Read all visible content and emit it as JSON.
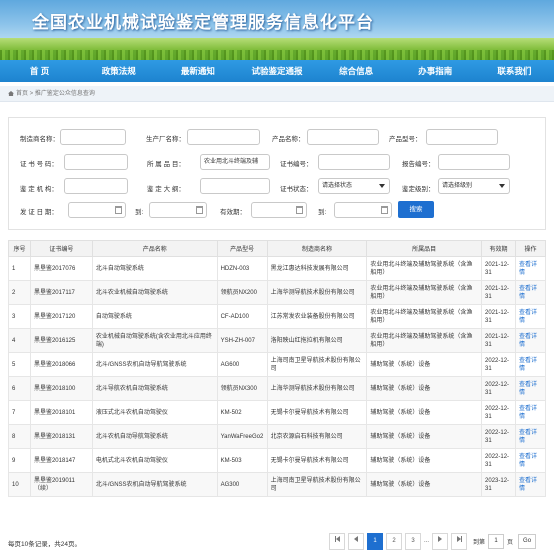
{
  "site": {
    "title": "全国农业机械试验鉴定管理服务信息化平台"
  },
  "nav": [
    "首 页",
    "政策法规",
    "最新通知",
    "试验鉴定通报",
    "综合信息",
    "办事指南",
    "联系我们"
  ],
  "breadcrumb": {
    "home": "首页",
    "sep": " > ",
    "current": "推广鉴定公众信息查询"
  },
  "search": {
    "manufacturer_label": "制造商名称：",
    "producer_label": "生产厂名称：",
    "product_label": "产品名称：",
    "model_label": "产品型号：",
    "cert_no_label": "证 书 号 码：",
    "category_label": "所 属 品 目：",
    "category_value": "农业用北斗终端及辅",
    "cert_id_label": "证书编号：",
    "report_label": "报告编号：",
    "agency_label": "鉴 定 机 构：",
    "outline_label": "鉴 定 大 纲：",
    "status_label": "证书状态：",
    "status_value": "请选择状态",
    "level_label": "鉴定级别：",
    "level_value": "请选择级别",
    "issue_date_label": "发 证 日 期：",
    "to_label": "到:",
    "validity_label": "有效期：",
    "to_label2": "到:",
    "button": "搜索"
  },
  "table": {
    "headers": [
      "序号",
      "证书编号",
      "产品名称",
      "产品型号",
      "制造商名称",
      "所属品目",
      "有效期",
      "操作"
    ],
    "rows": [
      {
        "no": "1",
        "cert": "黑垦鉴2017076",
        "name": "北斗自动驾驶系统",
        "model": "HDZN-003",
        "maker": "黑龙江惠达科技发展有限公司",
        "cat": "农业用北斗终端及辅助驾驶系统（含渔船用）",
        "valid": "2021-12-31",
        "op": "查看详情"
      },
      {
        "no": "2",
        "cert": "黑垦鉴2017117",
        "name": "北斗农业机械自动驾驶系统",
        "model": "领航员NX200",
        "maker": "上海华测导航技术股份有限公司",
        "cat": "农业用北斗终端及辅助驾驶系统（含渔船用）",
        "valid": "2021-12-31",
        "op": "查看详情"
      },
      {
        "no": "3",
        "cert": "黑垦鉴2017120",
        "name": "自动驾驶系统",
        "model": "CF-AD100",
        "maker": "江苏常发农业装备股份有限公司",
        "cat": "农业用北斗终端及辅助驾驶系统（含渔船用）",
        "valid": "2021-12-31",
        "op": "查看详情"
      },
      {
        "no": "4",
        "cert": "黑垦鉴2016125",
        "name": "农业机械自动驾驶系统(含农业用北斗应用终端)",
        "model": "YSH-ZH-007",
        "maker": "洛阳映山红拖拉机有限公司",
        "cat": "农业用北斗终端及辅助驾驶系统（含渔船用）",
        "valid": "2021-12-31",
        "op": "查看详情"
      },
      {
        "no": "5",
        "cert": "黑垦鉴2018066",
        "name": "北斗/GNSS农机自动导航驾驶系统",
        "model": "AG600",
        "maker": "上海司南卫星导航技术股份有限公司",
        "cat": "辅助驾驶（系统）设备",
        "valid": "2022-12-31",
        "op": "查看详情"
      },
      {
        "no": "6",
        "cert": "黑垦鉴2018100",
        "name": "北斗导航农机自动驾驶系统",
        "model": "领航员NX300",
        "maker": "上海华测导航技术股份有限公司",
        "cat": "辅助驾驶（系统）设备",
        "valid": "2022-12-31",
        "op": "查看详情"
      },
      {
        "no": "7",
        "cert": "黑垦鉴2018101",
        "name": "液压式北斗农机自动驾驶仪",
        "model": "KM-502",
        "maker": "无锡卡尔曼导航技术有限公司",
        "cat": "辅助驾驶（系统）设备",
        "valid": "2022-12-31",
        "op": "查看详情"
      },
      {
        "no": "8",
        "cert": "黑垦鉴2018131",
        "name": "北斗农机自动导航驾驶系统",
        "model": "YanWaFreeGo2",
        "maker": "北京农源启石科技有限公司",
        "cat": "辅助驾驶（系统）设备",
        "valid": "2022-12-31",
        "op": "查看详情"
      },
      {
        "no": "9",
        "cert": "黑垦鉴2018147",
        "name": "电机式北斗农机自动驾驶仪",
        "model": "KM-503",
        "maker": "无锡卡尔曼导航技术有限公司",
        "cat": "辅助驾驶（系统）设备",
        "valid": "2022-12-31",
        "op": "查看详情"
      },
      {
        "no": "10",
        "cert": "黑垦鉴2019011（续）",
        "name": "北斗/GNSS农机自动导航驾驶系统",
        "model": "AG300",
        "maker": "上海司南卫星导航技术股份有限公司",
        "cat": "辅助驾驶（系统）设备",
        "valid": "2023-12-31",
        "op": "查看详情"
      }
    ]
  },
  "pager": {
    "info": "每页10条记录，共24页。",
    "pages": [
      "1",
      "2",
      "3"
    ],
    "ellipsis": "...",
    "goto_label": "到第",
    "goto_value": "1",
    "page_unit": "页",
    "go_button": "Go"
  }
}
